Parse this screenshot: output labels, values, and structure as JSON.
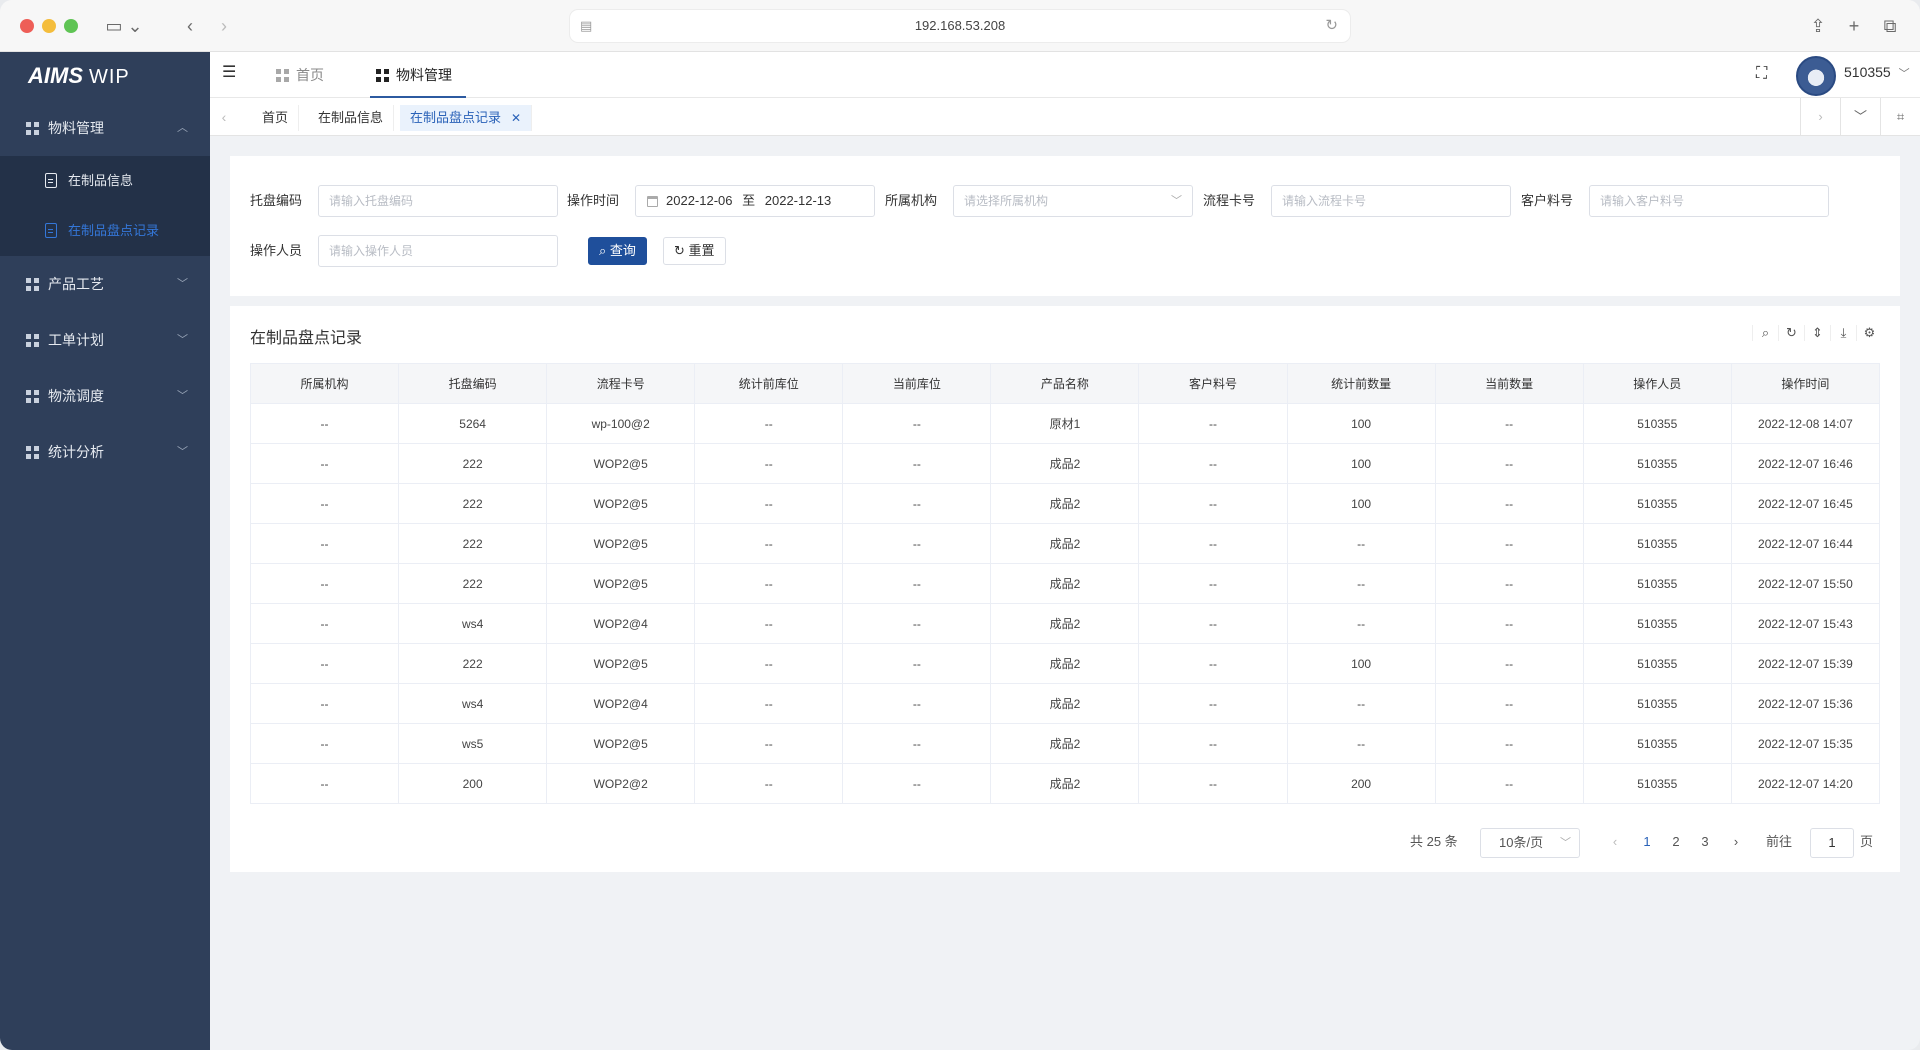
{
  "browser": {
    "url": "192.168.53.208"
  },
  "app": {
    "brand_main": "AIMS",
    "brand_sub": "WIP"
  },
  "sidebar": {
    "groups": [
      {
        "label": "物料管理",
        "expanded": true
      },
      {
        "label": "产品工艺"
      },
      {
        "label": "工单计划"
      },
      {
        "label": "物流调度"
      },
      {
        "label": "统计分析"
      }
    ],
    "sub_items": [
      {
        "label": "在制品信息"
      },
      {
        "label": "在制品盘点记录",
        "active": true
      }
    ]
  },
  "header": {
    "tabs": [
      {
        "label": "首页"
      },
      {
        "label": "物料管理",
        "active": true
      }
    ],
    "username": "510355"
  },
  "tagbar": {
    "tags": [
      {
        "label": "首页"
      },
      {
        "label": "在制品信息"
      },
      {
        "label": "在制品盘点记录",
        "active": true
      }
    ]
  },
  "filter": {
    "pallet_label": "托盘编码",
    "pallet_placeholder": "请输入托盘编码",
    "time_label": "操作时间",
    "date_start": "2022-12-06",
    "date_sep": "至",
    "date_end": "2022-12-13",
    "org_label": "所属机构",
    "org_placeholder": "请选择所属机构",
    "card_label": "流程卡号",
    "card_placeholder": "请输入流程卡号",
    "cust_label": "客户料号",
    "cust_placeholder": "请输入客户料号",
    "operator_label": "操作人员",
    "operator_placeholder": "请输入操作人员",
    "search_label": "查询",
    "reset_label": "重置"
  },
  "table": {
    "title": "在制品盘点记录",
    "columns": [
      "所属机构",
      "托盘编码",
      "流程卡号",
      "统计前库位",
      "当前库位",
      "产品名称",
      "客户料号",
      "统计前数量",
      "当前数量",
      "操作人员",
      "操作时间"
    ],
    "rows": [
      [
        "--",
        "5264",
        "wp-100@2",
        "--",
        "--",
        "原材1",
        "--",
        "100",
        "--",
        "510355",
        "2022-12-08 14:07"
      ],
      [
        "--",
        "222",
        "WOP2@5",
        "--",
        "--",
        "成品2",
        "--",
        "100",
        "--",
        "510355",
        "2022-12-07 16:46"
      ],
      [
        "--",
        "222",
        "WOP2@5",
        "--",
        "--",
        "成品2",
        "--",
        "100",
        "--",
        "510355",
        "2022-12-07 16:45"
      ],
      [
        "--",
        "222",
        "WOP2@5",
        "--",
        "--",
        "成品2",
        "--",
        "--",
        "--",
        "510355",
        "2022-12-07 16:44"
      ],
      [
        "--",
        "222",
        "WOP2@5",
        "--",
        "--",
        "成品2",
        "--",
        "--",
        "--",
        "510355",
        "2022-12-07 15:50"
      ],
      [
        "--",
        "ws4",
        "WOP2@4",
        "--",
        "--",
        "成品2",
        "--",
        "--",
        "--",
        "510355",
        "2022-12-07 15:43"
      ],
      [
        "--",
        "222",
        "WOP2@5",
        "--",
        "--",
        "成品2",
        "--",
        "100",
        "--",
        "510355",
        "2022-12-07 15:39"
      ],
      [
        "--",
        "ws4",
        "WOP2@4",
        "--",
        "--",
        "成品2",
        "--",
        "--",
        "--",
        "510355",
        "2022-12-07 15:36"
      ],
      [
        "--",
        "ws5",
        "WOP2@5",
        "--",
        "--",
        "成品2",
        "--",
        "--",
        "--",
        "510355",
        "2022-12-07 15:35"
      ],
      [
        "--",
        "200",
        "WOP2@2",
        "--",
        "--",
        "成品2",
        "--",
        "200",
        "--",
        "510355",
        "2022-12-07 14:20"
      ]
    ]
  },
  "pagination": {
    "total_text": "共 25 条",
    "page_size": "10条/页",
    "pages": [
      "1",
      "2",
      "3"
    ],
    "current": "1",
    "goto_label": "前往",
    "goto_value": "1",
    "page_unit": "页"
  },
  "colors": {
    "sidebar_bg": "#2f3f5a",
    "primary": "#1f4f9b",
    "active_link": "#2a62b8"
  },
  "icons": [
    "sidebar-toggle-icon",
    "share-icon",
    "new-tab-icon",
    "tabs-overview-icon",
    "fullscreen-icon",
    "search-icon",
    "refresh-icon",
    "sort-icon",
    "download-icon",
    "settings-icon"
  ]
}
